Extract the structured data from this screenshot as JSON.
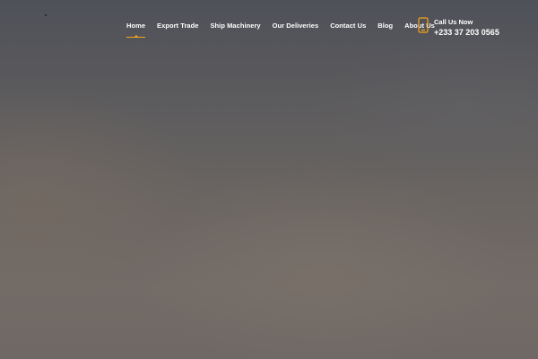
{
  "nav": {
    "items": [
      {
        "label": "Home",
        "active": true
      },
      {
        "label": "Export Trade",
        "active": false
      },
      {
        "label": "Ship Machinery",
        "active": false
      },
      {
        "label": "Our Deliveries",
        "active": false
      },
      {
        "label": "Contact Us",
        "active": false
      },
      {
        "label": "Blog",
        "active": false
      },
      {
        "label": "About Us",
        "active": false
      }
    ]
  },
  "call": {
    "label": "Call Us Now",
    "number": "+233 37 203 0565",
    "icon": "smartphone-icon"
  },
  "colors": {
    "accent": "#f3a31b",
    "text": "#ffffff",
    "background_top": "#4f5159",
    "background_bottom": "#736b66"
  }
}
